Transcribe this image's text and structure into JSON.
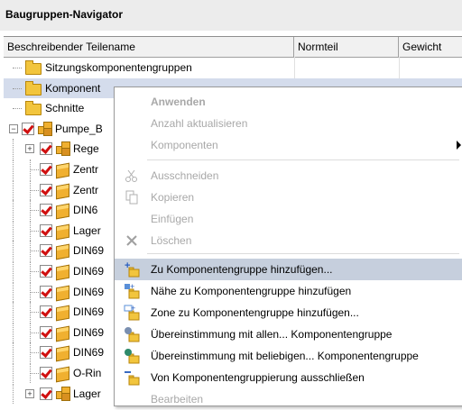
{
  "panel": {
    "title": "Baugruppen-Navigator"
  },
  "columns": [
    "Beschreibender Teilename",
    "Normteil",
    "Gewicht"
  ],
  "tree": [
    {
      "label": "Sitzungskomponentengruppen",
      "kind": "folder"
    },
    {
      "label": "Komponent",
      "kind": "folder",
      "selected": true
    },
    {
      "label": "Schnitte",
      "kind": "folder"
    },
    {
      "label": "Pumpe_B",
      "kind": "assembly",
      "expander": "minus"
    },
    {
      "label": "Rege",
      "kind": "assembly",
      "expander": "plus"
    },
    {
      "label": "Zentr",
      "kind": "part"
    },
    {
      "label": "Zentr",
      "kind": "part"
    },
    {
      "label": "DIN6",
      "kind": "part"
    },
    {
      "label": "Lager",
      "kind": "part"
    },
    {
      "label": "DIN69",
      "kind": "part"
    },
    {
      "label": "DIN69",
      "kind": "part"
    },
    {
      "label": "DIN69",
      "kind": "part"
    },
    {
      "label": "DIN69",
      "kind": "part"
    },
    {
      "label": "DIN69",
      "kind": "part"
    },
    {
      "label": "DIN69",
      "kind": "part"
    },
    {
      "label": "O-Rin",
      "kind": "part"
    },
    {
      "label": "Lager",
      "kind": "assembly",
      "expander": "plus"
    }
  ],
  "context_menu": {
    "items": [
      {
        "label": "Anwenden",
        "disabled": true,
        "bold": true
      },
      {
        "label": "Anzahl aktualisieren",
        "disabled": true
      },
      {
        "label": "Komponenten",
        "disabled": true,
        "submenu": true
      },
      {
        "label": "Ausschneiden",
        "disabled": true,
        "icon": "scissors-icon"
      },
      {
        "label": "Kopieren",
        "disabled": true,
        "icon": "copy-icon"
      },
      {
        "label": "Einfügen",
        "disabled": true
      },
      {
        "label": "Löschen",
        "disabled": true,
        "icon": "delete-x-icon"
      },
      {
        "label": "Zu Komponentengruppe hinzufügen...",
        "disabled": false,
        "highlighted": true,
        "icon": "add-to-group-icon"
      },
      {
        "label": "Nähe zu Komponentengruppe hinzufügen",
        "disabled": false,
        "icon": "proximity-add-icon"
      },
      {
        "label": "Zone zu Komponentengruppe hinzufügen...",
        "disabled": false,
        "icon": "zone-add-icon"
      },
      {
        "label": "Übereinstimmung mit allen... Komponentengruppe",
        "disabled": false,
        "icon": "match-all-icon"
      },
      {
        "label": "Übereinstimmung mit beliebigen... Komponentengruppe",
        "disabled": false,
        "icon": "match-any-icon"
      },
      {
        "label": "Von Komponentengruppierung ausschließen",
        "disabled": false,
        "icon": "exclude-icon"
      },
      {
        "label": "Bearbeiten",
        "disabled": true
      }
    ]
  },
  "colors": {
    "highlight": "#c6cfdd",
    "selection": "#d4dcec",
    "check": "#d01010",
    "folder": "#f2c53d"
  }
}
